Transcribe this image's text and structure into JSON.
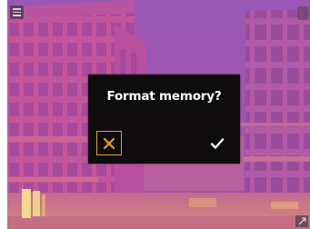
{
  "dialog": {
    "title": "Format memory?",
    "cancel_icon": "close-icon",
    "confirm_icon": "checkmark-icon"
  },
  "toolbar": {
    "menu_icon": "menu-icon",
    "expand_icon": "expand-icon"
  },
  "colors": {
    "accent": "#e8a317",
    "dialog_background": "#0e0c0d",
    "thermal_base": "#b24ea0"
  }
}
